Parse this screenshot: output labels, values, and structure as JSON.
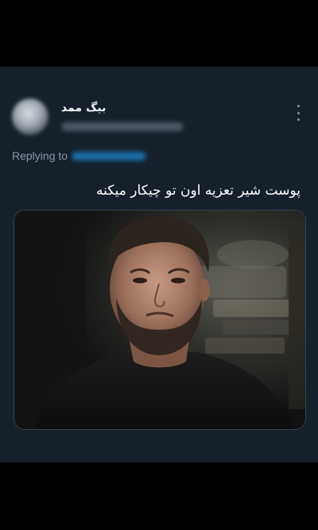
{
  "tweet": {
    "author_name": "بیگ ممد",
    "reply_label": "Replying to",
    "text": "پوست شیر تعزیه اون تو چیکار میکنه"
  },
  "icons": {
    "more": "more-vertical-icon"
  },
  "colors": {
    "page_background": "#000000",
    "card_background": "#15202b",
    "primary_text": "#ffffff",
    "secondary_text": "#8b98a5",
    "link_blue": "#1d9bf0"
  }
}
